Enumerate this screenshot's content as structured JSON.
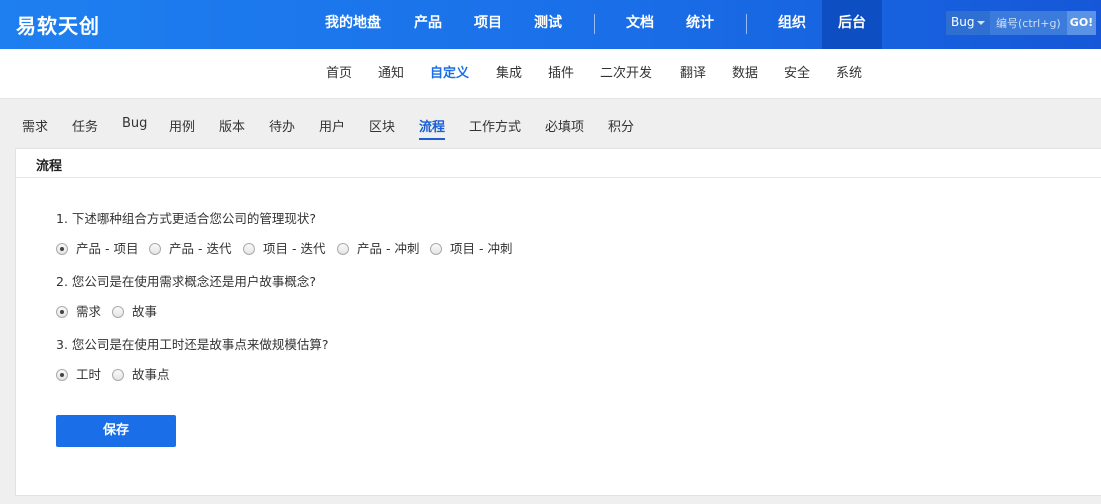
{
  "header": {
    "logo": "易软天创",
    "nav": [
      {
        "label": "我的地盘"
      },
      {
        "label": "产品"
      },
      {
        "label": "项目"
      },
      {
        "label": "测试"
      },
      {
        "label": "文档"
      },
      {
        "label": "统计"
      },
      {
        "label": "组织"
      },
      {
        "label": "后台",
        "active": true
      }
    ],
    "search": {
      "type": "Bug",
      "placeholder": "编号(ctrl+g)",
      "go": "GO!"
    }
  },
  "subnav": [
    {
      "label": "首页"
    },
    {
      "label": "通知"
    },
    {
      "label": "自定义",
      "active": true
    },
    {
      "label": "集成"
    },
    {
      "label": "插件"
    },
    {
      "label": "二次开发"
    },
    {
      "label": "翻译"
    },
    {
      "label": "数据"
    },
    {
      "label": "安全"
    },
    {
      "label": "系统"
    }
  ],
  "tabs": [
    {
      "label": "需求"
    },
    {
      "label": "任务"
    },
    {
      "label": "Bug"
    },
    {
      "label": "用例"
    },
    {
      "label": "版本"
    },
    {
      "label": "待办"
    },
    {
      "label": "用户"
    },
    {
      "label": "区块"
    },
    {
      "label": "流程",
      "active": true
    },
    {
      "label": "工作方式"
    },
    {
      "label": "必填项"
    },
    {
      "label": "积分"
    }
  ],
  "panel": {
    "title": "流程",
    "questions": [
      {
        "text": "1. 下述哪种组合方式更适合您公司的管理现状?",
        "options": [
          "产品 - 项目",
          "产品 - 迭代",
          "项目 - 迭代",
          "产品 - 冲刺",
          "项目 - 冲刺"
        ],
        "selected": 0
      },
      {
        "text": "2. 您公司是在使用需求概念还是用户故事概念?",
        "options": [
          "需求",
          "故事"
        ],
        "selected": 0
      },
      {
        "text": "3. 您公司是在使用工时还是故事点来做规模估算?",
        "options": [
          "工时",
          "故事点"
        ],
        "selected": 0
      }
    ],
    "save_label": "保存"
  },
  "colors": {
    "header_start": "#1e7ff0",
    "header_end": "#1557d8",
    "accent": "#1a6fe8"
  }
}
